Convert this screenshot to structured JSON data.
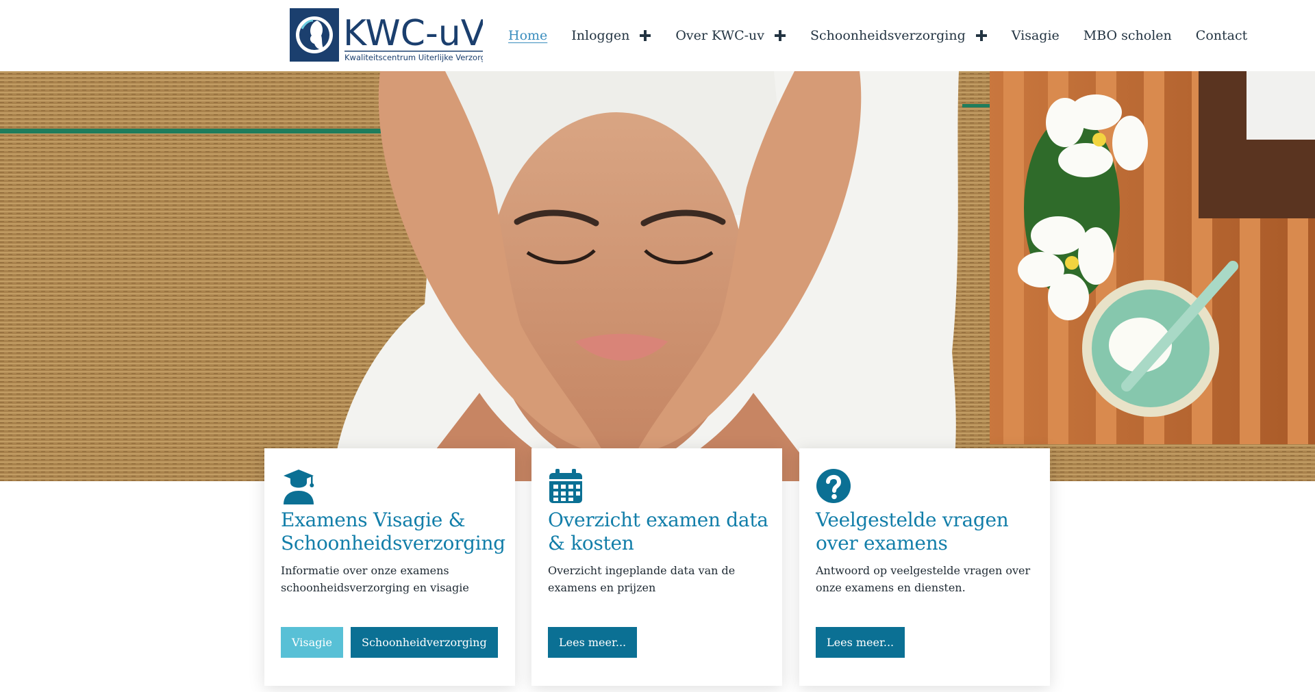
{
  "logo": {
    "name": "KWC-uV",
    "tagline": "Kwaliteitscentrum Uiterlijke Verzorging"
  },
  "nav": {
    "items": [
      {
        "label": "Home",
        "active": true,
        "has_submenu": false
      },
      {
        "label": "Inloggen",
        "active": false,
        "has_submenu": true
      },
      {
        "label": "Over KWC-uv",
        "active": false,
        "has_submenu": true
      },
      {
        "label": "Schoonheidsverzorging",
        "active": false,
        "has_submenu": true
      },
      {
        "label": "Visagie",
        "active": false,
        "has_submenu": false
      },
      {
        "label": "MBO scholen",
        "active": false,
        "has_submenu": false
      },
      {
        "label": "Contact",
        "active": false,
        "has_submenu": false
      }
    ]
  },
  "cards": [
    {
      "icon": "graduate-icon",
      "title": "Examens Visagie & Schoonheidsverzorging",
      "text": "Informatie over onze examens schoonheidsverzorging en visagie",
      "buttons": [
        "Visagie",
        "Schoonheidverzorging"
      ]
    },
    {
      "icon": "calendar-icon",
      "title": "Overzicht examen data & kosten",
      "text": "Overzicht ingeplande data van de examens en prijzen",
      "buttons": [
        "Lees meer..."
      ]
    },
    {
      "icon": "question-circle-icon",
      "title": "Veelgestelde vragen over examens",
      "text": "Antwoord op veelgestelde vragen over onze examens en diensten.",
      "buttons": [
        "Lees meer..."
      ]
    }
  ],
  "colors": {
    "brand_dark": "#0b7094",
    "brand_light": "#58c0d6",
    "heading": "#127ea9",
    "nav_active": "#3a8dbe",
    "logo_navy": "#1b3f6e"
  }
}
